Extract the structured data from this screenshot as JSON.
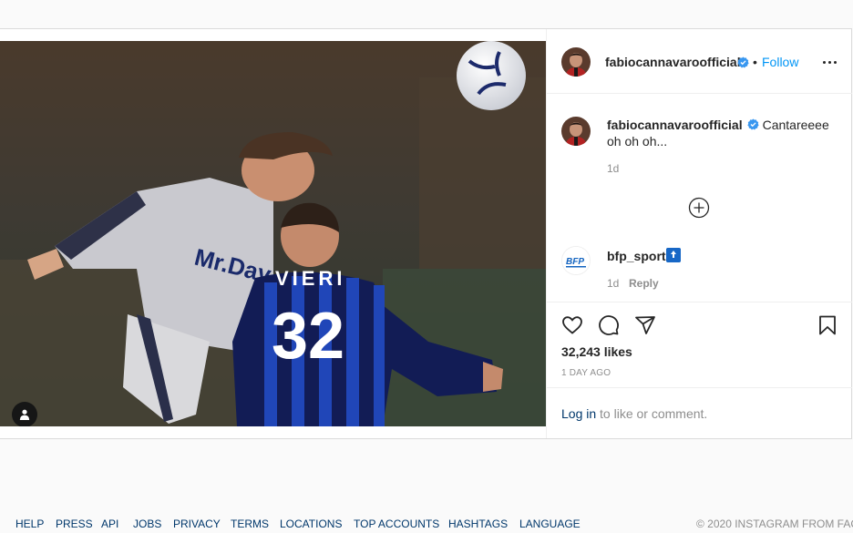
{
  "post": {
    "username": "fabiocannavaroofficial",
    "separator": "•",
    "follow_label": "Follow",
    "caption_username": "fabiocannavaroofficial",
    "caption_line1": "Cantareeee",
    "caption_line2": "oh oh oh...",
    "caption_time": "1d",
    "comment_username": "bfp_sport",
    "comment_time": "1d",
    "comment_reply": "Reply",
    "likes": "32,243 likes",
    "posted_ago": "1 DAY AGO",
    "login_link": "Log in",
    "login_suffix": " to like or comment."
  },
  "photo": {
    "jersey_sponsor": "Mr.Day",
    "jersey_name": "VIERI",
    "jersey_number": "32"
  },
  "footer": {
    "links": [
      "HELP",
      "PRESS",
      "API",
      "JOBS",
      "PRIVACY",
      "TERMS",
      "LOCATIONS",
      "TOP ACCOUNTS",
      "HASHTAGS",
      "LANGUAGE"
    ],
    "copyright": "© 2020 INSTAGRAM FROM FAC"
  },
  "icons": {
    "verified": "verified-badge-icon",
    "more": "more-options-icon",
    "plus": "load-more-comments-icon",
    "like": "heart-icon",
    "comment": "comment-bubble-icon",
    "share": "paper-plane-icon",
    "save": "bookmark-icon",
    "user_tag": "person-icon"
  },
  "colors": {
    "link": "#0095f6",
    "verified": "#3897f0",
    "text": "#262626",
    "muted": "#8e8e8e"
  }
}
